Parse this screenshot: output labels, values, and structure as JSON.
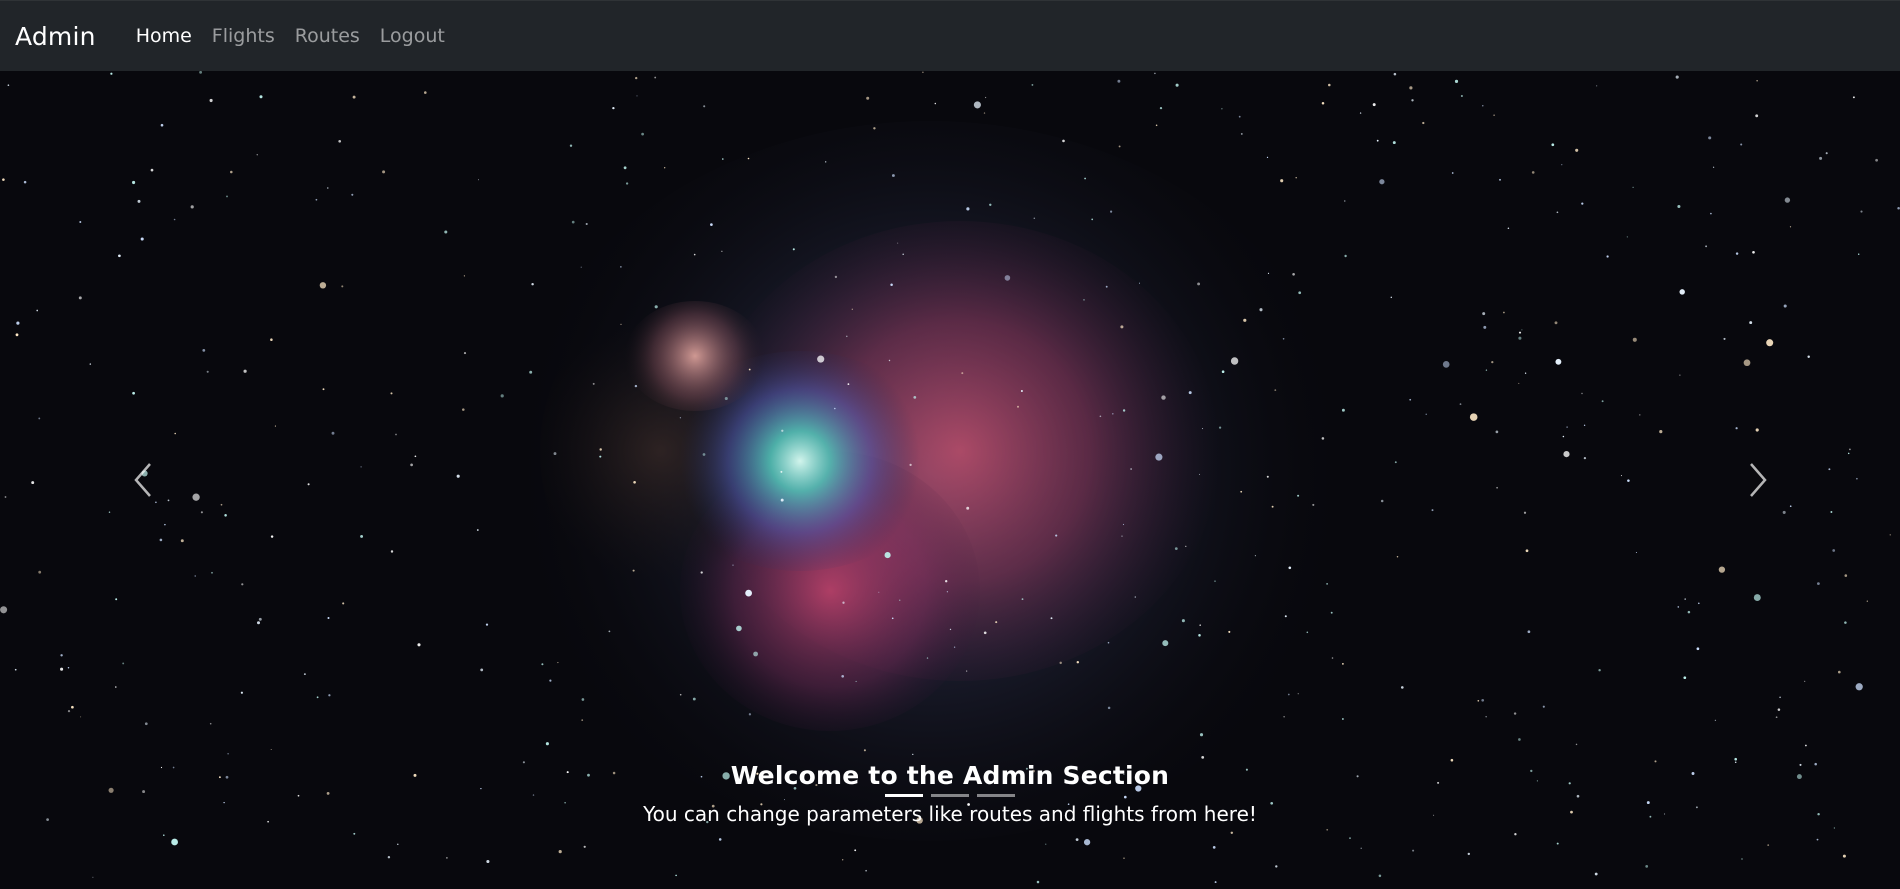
{
  "navbar": {
    "brand": "Admin",
    "links": [
      {
        "label": "Home",
        "active": true
      },
      {
        "label": "Flights",
        "active": false
      },
      {
        "label": "Routes",
        "active": false
      },
      {
        "label": "Logout",
        "active": false
      }
    ]
  },
  "carousel": {
    "caption_title": "Welcome to the Admin Section",
    "caption_text": "You can change parameters like routes and flights from here!",
    "slide_count": 3,
    "active_slide": 1,
    "prev_icon": "chevron-left-icon",
    "next_icon": "chevron-right-icon"
  },
  "colors": {
    "navbar_bg": "#212529",
    "text_active": "#ffffff",
    "text_muted": "rgba(255,255,255,0.55)"
  }
}
